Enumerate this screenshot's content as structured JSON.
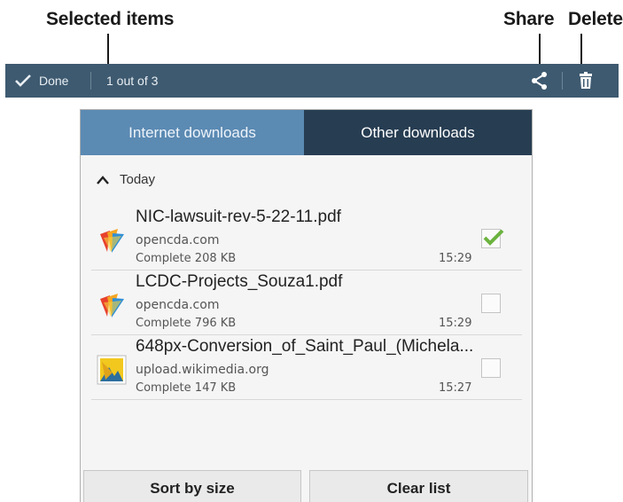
{
  "callouts": {
    "selected_items": "Selected items",
    "share": "Share",
    "delete": "Delete"
  },
  "actionbar": {
    "done_label": "Done",
    "done_icon": "checkmark-icon",
    "selection_count": "1 out of 3",
    "share_icon": "share-icon",
    "delete_icon": "trash-icon",
    "background": "#3e5a70"
  },
  "tabs": [
    {
      "label": "Internet downloads",
      "selected": true,
      "color": "#5b8ab3"
    },
    {
      "label": "Other downloads",
      "selected": false,
      "color": "#273d52"
    }
  ],
  "section": {
    "label": "Today",
    "icon": "chevron-up-icon"
  },
  "downloads": [
    {
      "name": "NIC-lawsuit-rev-5-22-11.pdf",
      "source": "opencda.com",
      "status": "Complete",
      "size": "208 KB",
      "time": "15:29",
      "icon": "pdf-file-icon",
      "checked": true
    },
    {
      "name": "LCDC-Projects_Souza1.pdf",
      "source": "opencda.com",
      "status": "Complete",
      "size": "796 KB",
      "time": "15:29",
      "icon": "pdf-file-icon",
      "checked": false
    },
    {
      "name": "648px-Conversion_of_Saint_Paul_(Michela...",
      "source": "upload.wikimedia.org",
      "status": "Complete",
      "size": "147 KB",
      "time": "15:27",
      "icon": "image-file-icon",
      "checked": false
    }
  ],
  "buttons": {
    "sort": "Sort by size",
    "clear": "Clear list"
  },
  "colors": {
    "checkmark": "#6cb33f"
  }
}
